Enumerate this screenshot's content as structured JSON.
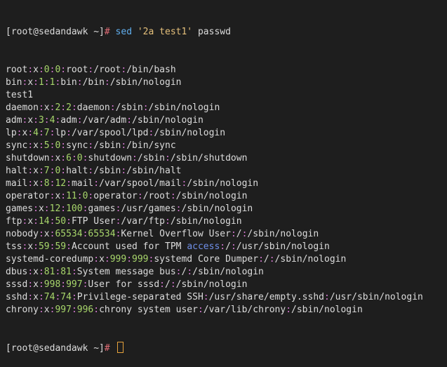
{
  "colors": {
    "background": "#1e1e1e",
    "text": "#dcdcdc",
    "separator": "#d67ad2",
    "number": "#a8d66b",
    "command": "#61afef",
    "string": "#e5c07b",
    "hash": "#e06c75",
    "keyword": "#6f8fe8",
    "cursor": "#e6a23c"
  },
  "prompt": {
    "text": "[root@sedandawk ~]",
    "hash": "#"
  },
  "command": {
    "name": "sed",
    "expression": "'2a test1'",
    "file": "passwd"
  },
  "output_lines": [
    "root:x:0:0:root:/root:/bin/bash",
    "bin:x:1:1:bin:/bin:/sbin/nologin",
    "test1",
    "daemon:x:2:2:daemon:/sbin:/sbin/nologin",
    "adm:x:3:4:adm:/var/adm:/sbin/nologin",
    "lp:x:4:7:lp:/var/spool/lpd:/sbin/nologin",
    "sync:x:5:0:sync:/sbin:/bin/sync",
    "shutdown:x:6:0:shutdown:/sbin:/sbin/shutdown",
    "halt:x:7:0:halt:/sbin:/sbin/halt",
    "mail:x:8:12:mail:/var/spool/mail:/sbin/nologin",
    "operator:x:11:0:operator:/root:/sbin/nologin",
    "games:x:12:100:games:/usr/games:/sbin/nologin",
    "ftp:x:14:50:FTP User:/var/ftp:/sbin/nologin",
    "nobody:x:65534:65534:Kernel Overflow User:/:/sbin/nologin",
    "tss:x:59:59:Account used for TPM access:/:/usr/sbin/nologin",
    "systemd-coredump:x:999:999:systemd Core Dumper:/:/sbin/nologin",
    "dbus:x:81:81:System message bus:/:/sbin/nologin",
    "sssd:x:998:997:User for sssd:/:/sbin/nologin",
    "sshd:x:74:74:Privilege-separated SSH:/usr/share/empty.sshd:/usr/sbin/nologin",
    "chrony:x:997:996:chrony system user:/var/lib/chrony:/sbin/nologin"
  ],
  "highlight_keywords": [
    "access"
  ]
}
